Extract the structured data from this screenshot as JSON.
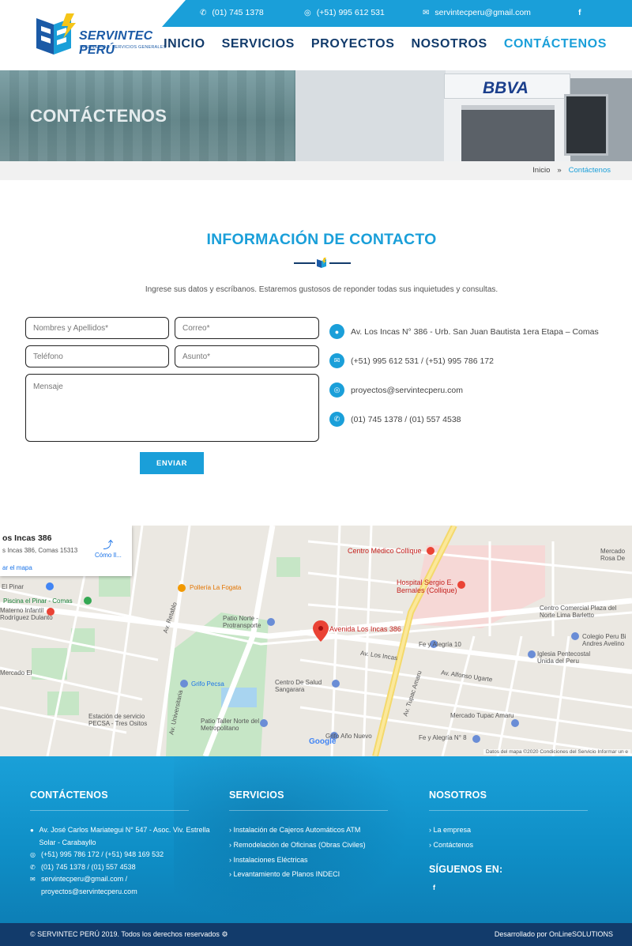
{
  "topbar": {
    "phone": "(01) 745 1378",
    "whatsapp": "(+51) 995 612 531",
    "email": "servintecperu@gmail.com",
    "social_icon": "facebook-icon"
  },
  "brand": {
    "name": "SERVINTEC PERÚ",
    "tagline": "INGENIERIA Y SERVICIOS GENERALES",
    "colors": {
      "primary": "#1a9fd9",
      "dark": "#123b6b",
      "accent": "#f5c518"
    }
  },
  "nav": {
    "items": [
      {
        "label": "INICIO"
      },
      {
        "label": "SERVICIOS"
      },
      {
        "label": "PROYECTOS"
      },
      {
        "label": "NOSOTROS"
      },
      {
        "label": "CONTÁCTENOS",
        "active": true
      }
    ]
  },
  "banner": {
    "title": "CONTÁCTENOS",
    "sign": "BBVA"
  },
  "breadcrumb": {
    "home": "Inicio",
    "separator": "»",
    "current": "Contáctenos"
  },
  "contact": {
    "title": "INFORMACIÓN DE CONTACTO",
    "intro": "Ingrese sus datos y escríbanos. Estaremos gustosos de reponder todas sus inquietudes y consultas.",
    "form": {
      "name_placeholder": "Nombres y Apellidos*",
      "email_placeholder": "Correo*",
      "phone_placeholder": "Teléfono",
      "subject_placeholder": "Asunto*",
      "message_placeholder": "Mensaje",
      "submit": "ENVIAR"
    },
    "info": [
      {
        "icon": "location-icon",
        "text": "Av. Los Incas N° 386 - Urb. San Juan Bautista 1era Etapa – Comas"
      },
      {
        "icon": "mail-icon",
        "text": "(+51) 995 612 531 / (+51) 995 786 172"
      },
      {
        "icon": "whatsapp-icon",
        "text": "proyectos@servintecperu.com"
      },
      {
        "icon": "phone-icon",
        "text": "(01) 745 1378 / (01) 557 4538"
      }
    ]
  },
  "map": {
    "card_title": "os Incas 386",
    "card_address": "s Incas 386, Comas 15313",
    "card_link": "ar el mapa",
    "directions": "Cómo ll...",
    "labels": [
      "Avenida Los Incas 386",
      "Centro Médico Collique",
      "Hospital Sergio E. Bernales (Collique)",
      "Pollería La Fogata",
      "Patio Norte - Protransporte",
      "Grifo Pecsa",
      "Patio Taller Norte del Metropolitano",
      "Estación de servicio PECSA - Tres Ositos",
      "Centro De Salud Sangarara",
      "Grifo Año Nuevo",
      "Fe y Alegría 10",
      "Fe y Alegría N° 8",
      "Mercado Tupac Amaru",
      "Colegio Peru Bi Andres Avelino",
      "Iglesia Pentecostal Unida del Peru",
      "Centro Comercial Plaza del Norte Lima Barletto",
      "Piscina el Pinar - Comas",
      "El Pinar",
      "Av. Tupac Amaru",
      "Av. Universitaria",
      "Av. Los Incas",
      "Av. Alfonso Ugarte",
      "Av. Retablo",
      "Mercado Rosa De",
      "Materno Infantil Rodríguez Dulanto",
      "Mercado El"
    ],
    "footer": "Datos del mapa ©2020   Condiciones del Servicio   Informar un e",
    "google": "Google"
  },
  "footer": {
    "col1": {
      "title": "CONTÁCTENOS",
      "address": "Av. José Carlos Mariategui N° 547 - Asoc. Viv. Estrella Solar - Carabayllo",
      "whatsapp": "(+51) 995 786 172 / (+51) 948 169 532",
      "phone": "(01) 745 1378 / (01) 557 4538",
      "email": "servintecperu@gmail.com / proyectos@servintecperu.com"
    },
    "col2": {
      "title": "SERVICIOS",
      "links": [
        "Instalación de Cajeros Automáticos ATM",
        "Remodelación de Oficinas (Obras Civiles)",
        "Instalaciones Eléctricas",
        "Levantamiento de Planos INDECI"
      ]
    },
    "col3": {
      "title": "NOSOTROS",
      "links": [
        "La empresa",
        "Contáctenos"
      ],
      "follow": "SÍGUENOS EN:"
    },
    "copyright": "© SERVINTEC PERÚ 2019. Todos los derechos reservados",
    "credit": "Desarrollado por OnLineSOLUTIONS"
  }
}
